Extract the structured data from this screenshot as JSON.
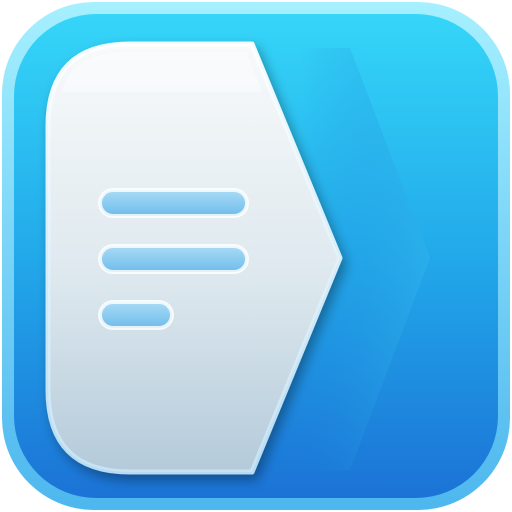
{
  "icon": {
    "name": "document-arrow-app-icon",
    "glyph": "document-with-text-lines-and-chevron",
    "colors": {
      "background_top": "#2FD0F6",
      "background_bottom": "#1A78D8",
      "rim_light": "#9BE8FF",
      "document_top": "#F7F9FA",
      "document_bottom": "#B9CEDA",
      "text_line_fill": "#7FC7F0",
      "text_line_stroke": "#5AA9DD"
    },
    "text_lines": 3
  }
}
